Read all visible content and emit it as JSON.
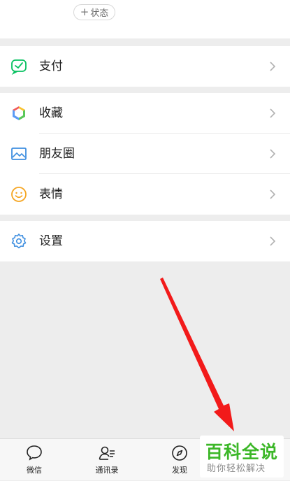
{
  "profile": {
    "status_button_label": "状态"
  },
  "menu": {
    "pay": "支付",
    "favorites": "收藏",
    "moments": "朋友圈",
    "stickers": "表情",
    "settings": "设置"
  },
  "tabbar": {
    "tabs": [
      {
        "label": "微信",
        "icon": "chat-bubble-icon"
      },
      {
        "label": "通讯录",
        "icon": "contacts-icon"
      },
      {
        "label": "发现",
        "icon": "compass-icon"
      }
    ]
  },
  "watermark": {
    "title": "百科全说",
    "subtitle": "助你轻松解决"
  },
  "colors": {
    "accent_green": "#07c160",
    "arrow_red": "#f21a1a",
    "watermark_green": "#3cb728"
  }
}
